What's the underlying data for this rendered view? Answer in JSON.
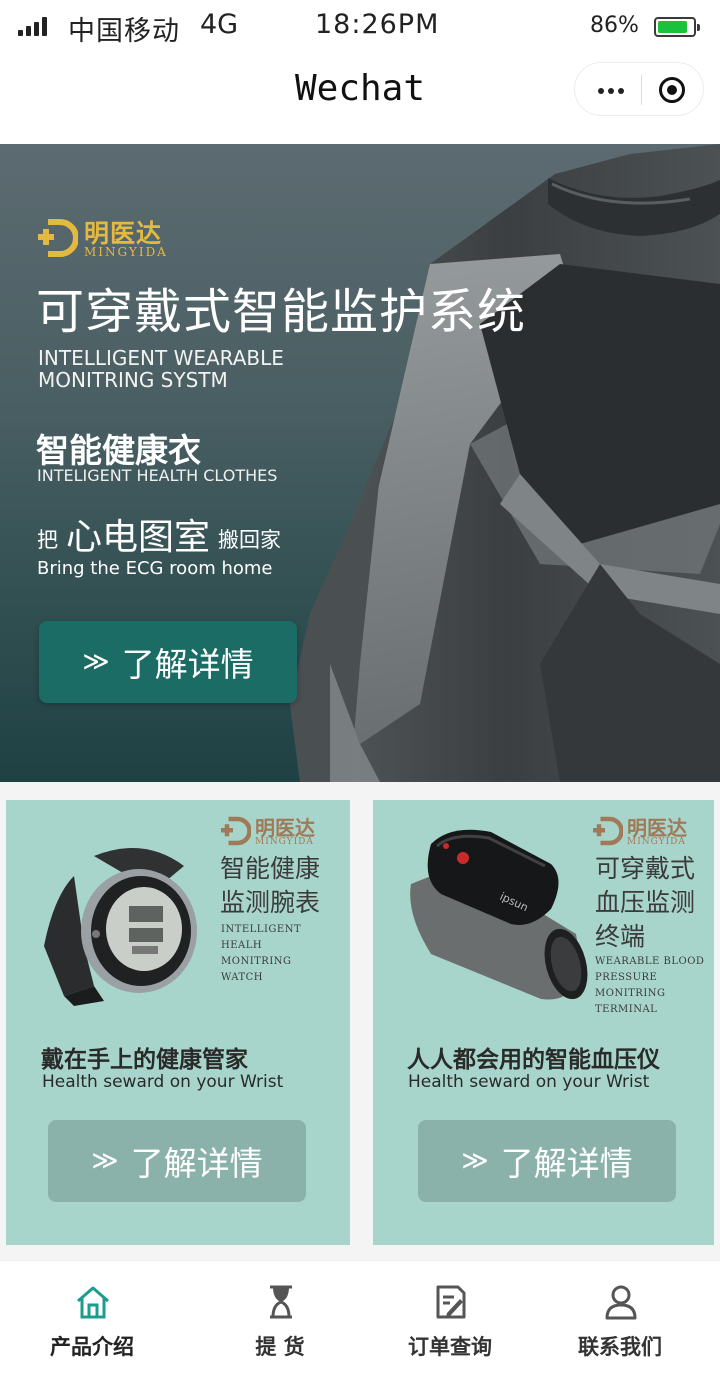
{
  "status_bar": {
    "carrier": "中国移动",
    "network": "4G",
    "time": "18:26PM",
    "battery": "86%",
    "battery_level": 0.86
  },
  "nav": {
    "title": "Wechat",
    "more_icon": "more-dots-icon",
    "close_icon": "target-close-icon"
  },
  "hero": {
    "brand_cn": "明医达",
    "brand_en": "MINGYIDA",
    "title": "可穿戴式智能监护系统",
    "en_line1": "INTELLIGENT WEARABLE",
    "en_line2": "MONITRING SYSTM",
    "product_cn": "智能健康衣",
    "product_en": "INTELIGENT HEALTH CLOTHES",
    "slogan_pre": "把",
    "slogan_main": "心电图室",
    "slogan_post": "搬回家",
    "slogan_en": "Bring the ECG room home",
    "button_arrow": "≫",
    "button_label": "了解详情"
  },
  "cards": [
    {
      "brand_cn": "明医达",
      "brand_en": "MINGYIDA",
      "title_lines": [
        "智能健康",
        "监测腕表"
      ],
      "en_lines": [
        "INTELLIGENT",
        "HEALH",
        "MONITRING",
        "WATCH"
      ],
      "headline": "戴在手上的健康管家",
      "headline_en": "Health seward on your Wrist",
      "button_arrow": "≫",
      "button_label": "了解详情"
    },
    {
      "brand_cn": "明医达",
      "brand_en": "MINGYIDA",
      "title_lines": [
        "可穿戴式",
        "血压监测",
        "终端"
      ],
      "en_lines": [
        "WEARABLE BLOOD",
        "PRESSURE",
        "MONITRING",
        "TERMINAL"
      ],
      "device_text": "ipsun",
      "headline": "人人都会用的智能血压仪",
      "headline_en": "Health seward on your Wrist",
      "button_arrow": "≫",
      "button_label": "了解详情"
    }
  ],
  "tabbar": [
    {
      "label": "产品介绍",
      "icon": "home-icon",
      "active": true
    },
    {
      "label": "提 货",
      "icon": "hourglass-icon",
      "active": false
    },
    {
      "label": "订单查询",
      "icon": "edit-document-icon",
      "active": false
    },
    {
      "label": "联系我们",
      "icon": "user-icon",
      "active": false
    }
  ],
  "colors": {
    "accent": "#1c9c8c",
    "hero_button": "#1c6c66",
    "card_bg": "#a8d5cb",
    "card_button": "#8bb2aa",
    "brand_gold": "#e5b93f",
    "brand_brown": "#a07a58"
  }
}
